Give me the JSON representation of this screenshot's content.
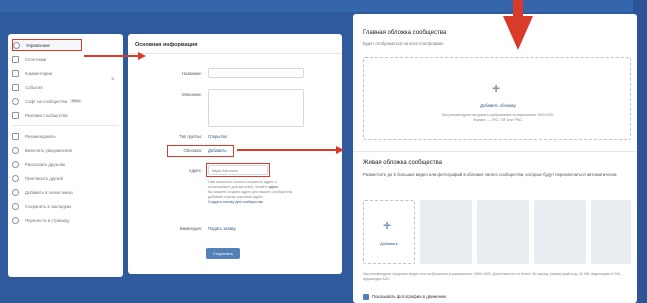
{
  "colors": {
    "annotation_red": "#d93b2b",
    "accent_blue": "#5181b8",
    "link_blue": "#2a5885"
  },
  "sidebar": {
    "items": [
      {
        "label": "Управление",
        "icon": "gear-icon"
      },
      {
        "label": "Сплетники",
        "icon": "list-icon"
      },
      {
        "label": "Комментарии",
        "icon": "comment-icon"
      },
      {
        "label": "События",
        "icon": "calendar-icon"
      },
      {
        "label": "Софт на сообщества",
        "badge": "Beta",
        "icon": "globe-icon"
      },
      {
        "label": "Реклама сообщества",
        "icon": "ad-icon"
      },
      {
        "label": "Рекомендовать",
        "icon": "thumb-icon"
      },
      {
        "label": "Включить уведомления",
        "icon": "bell-icon"
      },
      {
        "label": "Рассказать друзьям",
        "icon": "share-icon"
      },
      {
        "label": "Пригласить друзей",
        "icon": "invite-icon"
      },
      {
        "label": "Добавить в левое меню",
        "icon": "plus-icon"
      },
      {
        "label": "Сохранить в закладках",
        "icon": "star-icon"
      },
      {
        "label": "Перенести в страницу",
        "icon": "transfer-icon"
      }
    ],
    "close": "×"
  },
  "main_info": {
    "title": "Основная информация",
    "name_label": "Название:",
    "desc_label": "Описание:",
    "group_type_label": "Тип группы:",
    "group_type_value": "Открытая",
    "cover_label": "Обложка:",
    "cover_value": "Добавить",
    "address_label": "Адрес:",
    "address_value": "https://vk.com/",
    "address_hint_1": "Нам пришлось сильно сократить адрес и",
    "address_hint_2": "использовать для жителей, читайте",
    "address_hint_link": "здесь",
    "address_hint_3": "Вы можете создать адрес для вашего сообщества",
    "address_hint_4": "добавьте ссылку короткий адрес.",
    "address_hint_link2": "Создать ссылку для сообщества",
    "wiki_label": "Википедия:",
    "wiki_value": "Подать заявку",
    "save_label": "Сохранить"
  },
  "cover_section": {
    "title": "Главная обложка сообщества",
    "subtitle": "Будет отображаться на всех платформах",
    "add_label": "Добавить обложку",
    "hint_1": "Мы рекомендуем загружать изображение в разрешении 1590×530.",
    "hint_2": "Формат — JPG, GIF или PNG."
  },
  "live_section": {
    "title": "Живая обложка сообщества",
    "desc": "Разместите до 5 больших видео или фотографий в обложке своего сообщества, которые будут переключаться автоматически.",
    "add_label": "Добавить",
    "hint": "Мы рекомендуем загружать видео или изображения в разрешении 1080×1920. Длительность не более 30 секунд, размер файла до 20 МБ, видеокодек H.264, аудиокодек AAC.",
    "checkbox_label": "Показывать фотографии в движении",
    "checkbox_checked": true
  }
}
